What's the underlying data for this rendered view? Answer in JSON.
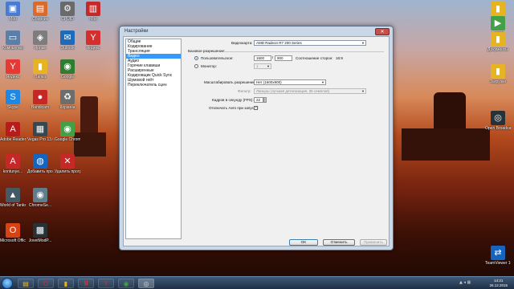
{
  "desktop_icons_left": [
    {
      "label": "Мой",
      "glyph": "▣",
      "color": "#4a7bd0"
    },
    {
      "label": "Сборник",
      "glyph": "▤",
      "color": "#d96a2b"
    },
    {
      "label": "CPUID",
      "glyph": "⚙",
      "color": "#6a6a6a"
    },
    {
      "label": "Мои",
      "glyph": "▥",
      "color": "#c62828"
    },
    {
      "label": "Компьютер",
      "glyph": "▭",
      "color": "#5b7fa8"
    },
    {
      "label": "Ярлык",
      "glyph": "◈",
      "color": "#7d7d7d"
    },
    {
      "label": "Outlook",
      "glyph": "✉",
      "color": "#1e6bb8"
    },
    {
      "label": "Яндекс",
      "glyph": "Y",
      "color": "#d32f2f"
    },
    {
      "label": "Яндекс",
      "glyph": "Y",
      "color": "#e53935"
    },
    {
      "label": "Папка",
      "glyph": "▮",
      "color": "#e6b422"
    },
    {
      "label": "Google",
      "glyph": "◉",
      "color": "#2e7d32"
    },
    {
      "label": "Skype",
      "glyph": "S",
      "color": "#1e88e5"
    },
    {
      "label": "Bandicam",
      "glyph": "●",
      "color": "#c62828"
    },
    {
      "label": "Корзина",
      "glyph": "♻",
      "color": "#6d6d6d"
    },
    {
      "label": "Adobe Reader X",
      "glyph": "A",
      "color": "#b71c1c"
    },
    {
      "label": "Vegas Pro 13.0 (64-bit)",
      "glyph": "▦",
      "color": "#37474f"
    },
    {
      "label": "Google Chrome",
      "glyph": "◉",
      "color": "#43a047"
    },
    {
      "label": "kontunye...",
      "glyph": "A",
      "color": "#c62828"
    },
    {
      "label": "Добавить программу",
      "glyph": "◍",
      "color": "#1565c0"
    },
    {
      "label": "Удалить программу",
      "glyph": "✕",
      "color": "#c62828"
    },
    {
      "label": "World of Tanks",
      "glyph": "▲",
      "color": "#455a64"
    },
    {
      "label": "ChromeSe...",
      "glyph": "◉",
      "color": "#607d8b"
    },
    {
      "label": "Microsoft Office",
      "glyph": "O",
      "color": "#d84315"
    },
    {
      "label": "JovetModP...",
      "glyph": "▩",
      "color": "#263238"
    }
  ],
  "desktop_icons_right": [
    {
      "label": "Фото",
      "glyph": "▮",
      "color": "#e6b422"
    },
    {
      "label": "Видео",
      "glyph": "▶",
      "color": "#43a047"
    },
    {
      "label": "Документы",
      "glyph": "▮",
      "color": "#e6b422"
    },
    {
      "label": "Загрузки",
      "glyph": "▮",
      "color": "#e6b422"
    },
    {
      "label": "Open Broadcast",
      "glyph": "◎",
      "color": "#263238"
    },
    {
      "label": "TeamViewer 10",
      "glyph": "⇄",
      "color": "#1565c0"
    }
  ],
  "dialog": {
    "title": "Настройки",
    "close_glyph": "✕",
    "nav_items": [
      "Общие",
      "Кодирование",
      "Трансляция",
      "Видео",
      "Аудио",
      "Горячие клавиши",
      "Расширенные",
      "Кодировщик Quick Sync",
      "Шумовой гейт",
      "Переключатель сцен"
    ],
    "active_nav": "Видео",
    "video": {
      "adapter_label": "Видеокарта:",
      "adapter_value": "AMD Radeon R7 200 Series",
      "base_resolution_label": "Базовое разрешение:",
      "custom_label": "Пользовательское:",
      "width": "1600",
      "height": "900",
      "aspect_label": "Соотношение сторон:",
      "aspect_value": "16:9",
      "monitor_label": "Монитор:",
      "monitor_value": "1",
      "downscale_label": "Масштабировать разрешение:",
      "downscale_value": "Нет (1600x900)",
      "filter_label": "Фильтр:",
      "filter_value": "Ланцош (лучшая детализация, 36 семплов)",
      "fps_label": "Кадров в секунду (FPS):",
      "fps_value": "22",
      "aero_label": "Отключать Aero при запуске:",
      "aero_checked": true
    },
    "buttons": {
      "ok": "OK",
      "cancel": "Отменить",
      "apply": "Применить"
    }
  },
  "taskbar": {
    "apps": [
      {
        "name": "explorer",
        "glyph": "▤",
        "color": "#e6b422"
      },
      {
        "name": "opera",
        "glyph": "O",
        "color": "#d32f2f"
      },
      {
        "name": "folder",
        "glyph": "▮",
        "color": "#e6b422"
      },
      {
        "name": "yandex",
        "glyph": "Я",
        "color": "#e53935"
      },
      {
        "name": "yandex-browser",
        "glyph": "Y",
        "color": "#d32f2f"
      },
      {
        "name": "chrome",
        "glyph": "◉",
        "color": "#43a047"
      },
      {
        "name": "obs",
        "glyph": "◎",
        "color": "#cfd8dc"
      }
    ],
    "time": "14:21",
    "date": "26.12.2015",
    "tray": "▲ ◂ ▦"
  }
}
